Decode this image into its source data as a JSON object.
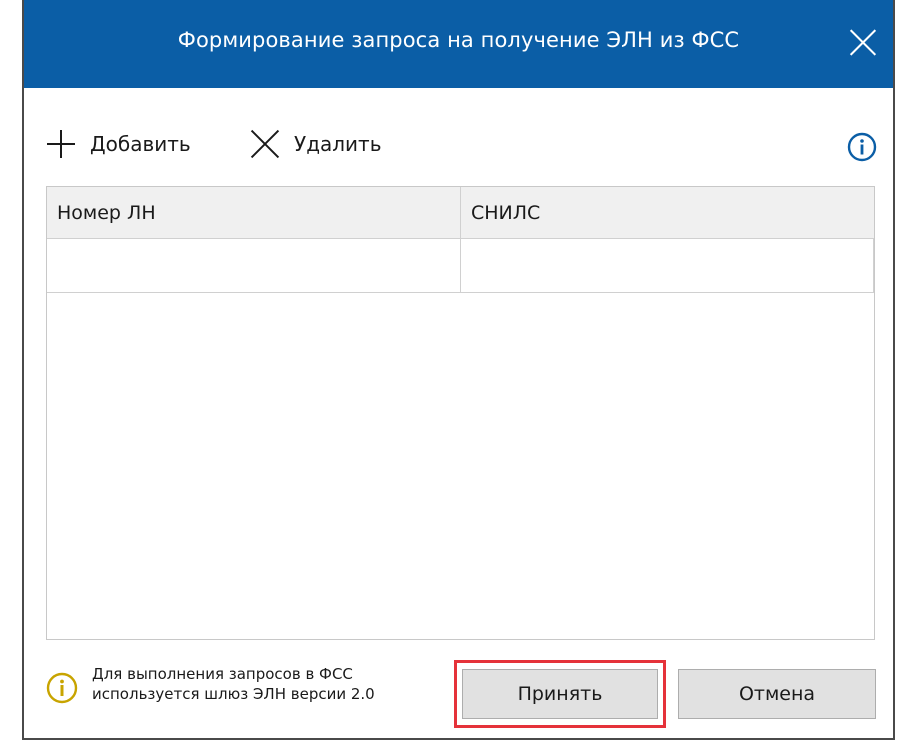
{
  "window": {
    "title": "Формирование запроса на получение ЭЛН из ФСС"
  },
  "toolbar": {
    "add_label": "Добавить",
    "delete_label": "Удалить"
  },
  "table": {
    "columns": [
      "Номер ЛН",
      "СНИЛС"
    ],
    "rows": [
      [
        "",
        ""
      ]
    ]
  },
  "footer": {
    "info_line1": "Для выполнения запросов в ФСС",
    "info_line2": "используется шлюз ЭЛН версии 2.0",
    "accept_label": "Принять",
    "cancel_label": "Отмена"
  },
  "colors": {
    "titlebar": "#0b5ea6",
    "info_top_icon": "#0b5ea6",
    "info_footer_icon": "#c8a400",
    "highlight": "#e5323a"
  },
  "icons": {
    "close": "close-icon",
    "add": "plus-icon",
    "delete": "x-icon",
    "info_top": "info-icon",
    "info_footer": "info-icon"
  }
}
